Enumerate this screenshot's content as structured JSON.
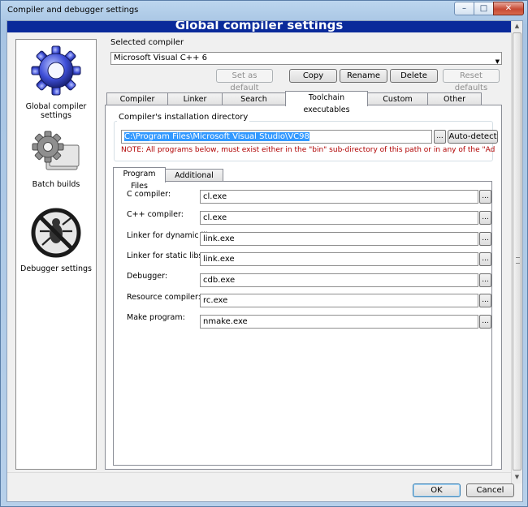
{
  "window": {
    "title": "Compiler and debugger settings",
    "close_glyph": "✕",
    "min_glyph": "–",
    "max_glyph": "□"
  },
  "header": {
    "banner": "Global compiler settings"
  },
  "left_panel": {
    "items": [
      {
        "label": "Global compiler settings",
        "icon": "gear-icon"
      },
      {
        "label": "Batch builds",
        "icon": "batch-gear-icon"
      },
      {
        "label": "Debugger settings",
        "icon": "debugger-bug-icon"
      }
    ]
  },
  "compiler": {
    "label": "Selected compiler",
    "value": "Microsoft Visual C++ 6",
    "dropdown_glyph": "▼"
  },
  "actions": {
    "set_default": "Set as default",
    "copy": "Copy",
    "rename": "Rename",
    "delete": "Delete",
    "reset_defaults": "Reset defaults"
  },
  "tabs": [
    "Compiler settings",
    "Linker settings",
    "Search directories",
    "Toolchain executables",
    "Custom variables",
    "Other settings"
  ],
  "install_dir": {
    "title": "Compiler's installation directory",
    "value": "C:\\Program Files\\Microsoft Visual Studio\\VC98",
    "browse": "...",
    "autodetect": "Auto-detect",
    "note": "NOTE: All programs below, must exist either in the \"bin\" sub-directory of this path or in any of the \"Additional"
  },
  "subtabs": [
    "Program Files",
    "Additional Paths"
  ],
  "programs": [
    {
      "label": "C compiler:",
      "value": "cl.exe"
    },
    {
      "label": "C++ compiler:",
      "value": "cl.exe"
    },
    {
      "label": "Linker for dynamic libs:",
      "value": "link.exe"
    },
    {
      "label": "Linker for static libs:",
      "value": "link.exe"
    },
    {
      "label": "Debugger:",
      "value": "cdb.exe"
    },
    {
      "label": "Resource compiler:",
      "value": "rc.exe"
    },
    {
      "label": "Make program:",
      "value": "nmake.exe"
    }
  ],
  "browse_glyph": "...",
  "dialog_buttons": {
    "ok": "OK",
    "cancel": "Cancel"
  },
  "colors": {
    "banner": "#0a2a9a",
    "note": "#b00000",
    "selection": "#3399ff"
  }
}
